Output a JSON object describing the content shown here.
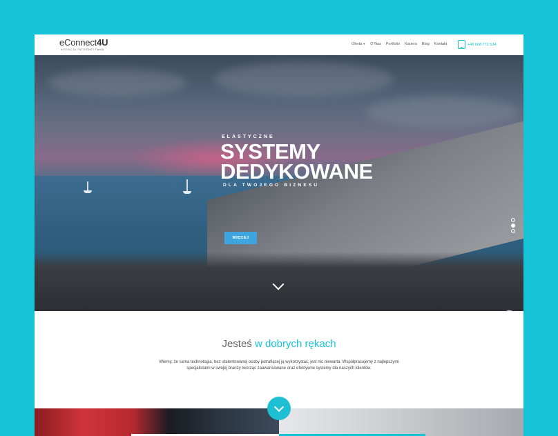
{
  "header": {
    "logo_prefix": "eConnect",
    "logo_suffix": "4U",
    "logo_tagline": "AGENCJA INTERAKTYWNA",
    "nav": [
      {
        "label": "Oferta"
      },
      {
        "label": "O Nas"
      },
      {
        "label": "Portfolio"
      },
      {
        "label": "Kariera"
      },
      {
        "label": "Blog"
      },
      {
        "label": "Kontakt"
      }
    ],
    "phone": "+48 668 772 534"
  },
  "hero": {
    "eyebrow": "ELASTYCZNE",
    "headline_line1": "SYSTEMY",
    "headline_line2": "DEDYKOWANE",
    "tagline": "DLA TWOJEGO BIZNESU",
    "cta_label": "WIĘCEJ",
    "slider": {
      "total": 3,
      "active": 2
    }
  },
  "intro": {
    "title_plain": "Jesteś ",
    "title_accent": "w dobrych rękach",
    "body": "Wiemy, że sama technologia, bez utalentowanej osoby potrafiącej ją wykorzystać, jest nic niewarta. Współpracujemy z najlepszymi specjalistami w swojej branży tworząc zaawansowane oraz efektywne systemy dla naszych klientów."
  },
  "colors": {
    "background": "#17c3d6",
    "accent": "#17c3d6",
    "cta": "#3fa5de",
    "messenger": "#2a8fe0"
  },
  "icons": [
    "caret-down-icon",
    "phone-icon",
    "chevron-down-icon",
    "messenger-icon",
    "slider-dot-icon"
  ]
}
